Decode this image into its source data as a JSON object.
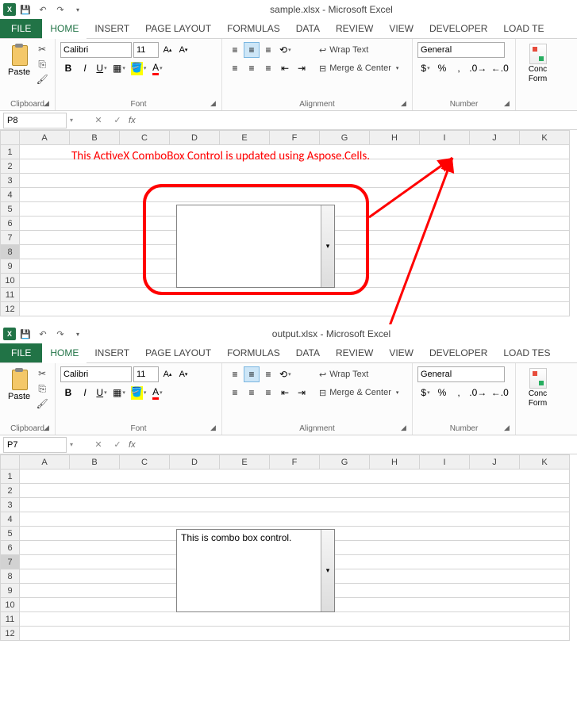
{
  "top": {
    "title": "sample.xlsx - Microsoft Excel",
    "tabs": {
      "file": "FILE",
      "home": "HOME",
      "insert": "INSERT",
      "page": "PAGE LAYOUT",
      "formulas": "FORMULAS",
      "data": "DATA",
      "review": "REVIEW",
      "view": "VIEW",
      "developer": "DEVELOPER",
      "load": "LOAD TE"
    },
    "clipboard": {
      "paste": "Paste",
      "group": "Clipboard"
    },
    "font": {
      "name": "Calibri",
      "size": "11",
      "group": "Font"
    },
    "alignment": {
      "wrap": "Wrap Text",
      "merge": "Merge & Center",
      "group": "Alignment"
    },
    "number": {
      "format": "General",
      "group": "Number"
    },
    "styles": {
      "cond": "Conc",
      "form": "Form"
    },
    "namebox": "P8",
    "cols": [
      "A",
      "B",
      "C",
      "D",
      "E",
      "F",
      "G",
      "H",
      "I",
      "J",
      "K"
    ],
    "rows": [
      "1",
      "2",
      "3",
      "4",
      "5",
      "6",
      "7",
      "8",
      "9",
      "10",
      "11",
      "12"
    ],
    "selRow": "8",
    "callout": "This ActiveX ComboBox Control is updated using Aspose.Cells.",
    "combo_text": ""
  },
  "bottom": {
    "title": "output.xlsx - Microsoft Excel",
    "tabs": {
      "file": "FILE",
      "home": "HOME",
      "insert": "INSERT",
      "page": "PAGE LAYOUT",
      "formulas": "FORMULAS",
      "data": "DATA",
      "review": "REVIEW",
      "view": "VIEW",
      "developer": "DEVELOPER",
      "load": "LOAD TES"
    },
    "clipboard": {
      "paste": "Paste",
      "group": "Clipboard"
    },
    "font": {
      "name": "Calibri",
      "size": "11",
      "group": "Font"
    },
    "alignment": {
      "wrap": "Wrap Text",
      "merge": "Merge & Center",
      "group": "Alignment"
    },
    "number": {
      "format": "General",
      "group": "Number"
    },
    "styles": {
      "cond": "Conc",
      "form": "Form"
    },
    "namebox": "P7",
    "cols": [
      "A",
      "B",
      "C",
      "D",
      "E",
      "F",
      "G",
      "H",
      "I",
      "J",
      "K"
    ],
    "rows": [
      "1",
      "2",
      "3",
      "4",
      "5",
      "6",
      "7",
      "8",
      "9",
      "10",
      "11",
      "12"
    ],
    "selRow": "7",
    "combo_text": "This is combo box control."
  }
}
